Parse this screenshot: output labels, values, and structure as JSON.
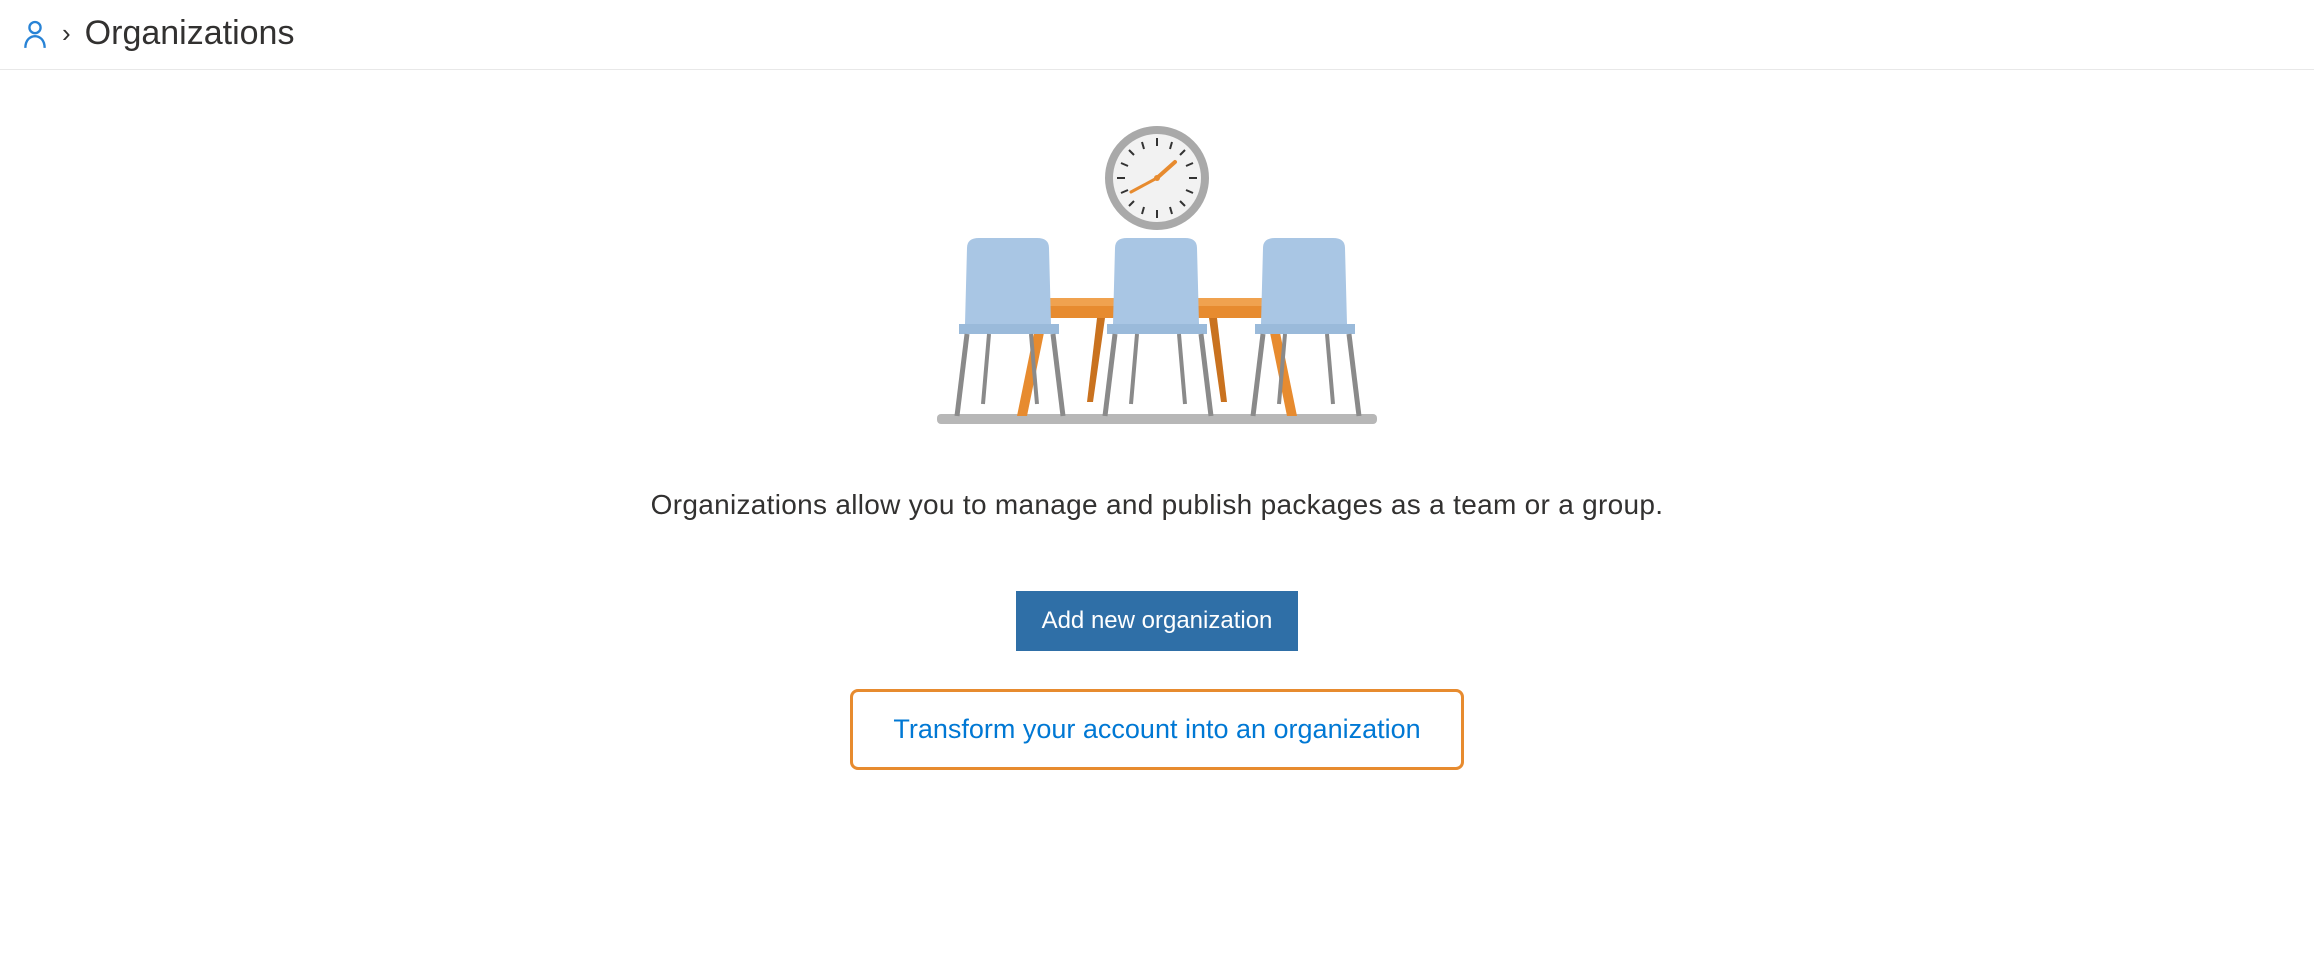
{
  "breadcrumb": {
    "title": "Organizations"
  },
  "main": {
    "description": "Organizations allow you to manage and publish packages as a team or a group.",
    "add_button_label": "Add new organization",
    "transform_button_label": "Transform your account into an organization"
  }
}
